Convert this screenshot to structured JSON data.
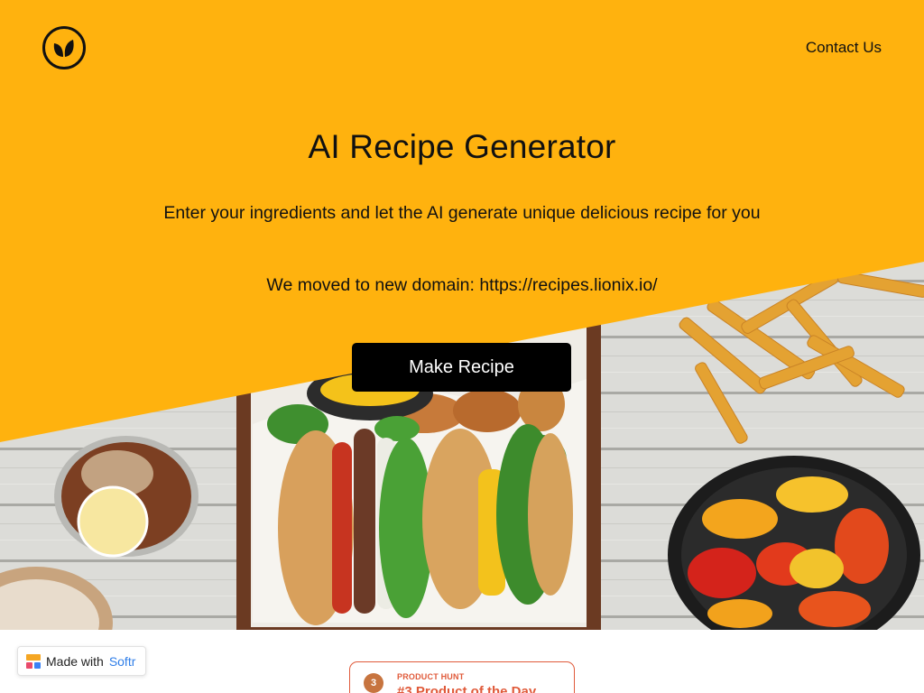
{
  "header": {
    "logo_icon": "leaf-icon",
    "contact_label": "Contact Us"
  },
  "hero": {
    "title": "AI Recipe Generator",
    "subtitle": "Enter your ingredients and let the AI generate unique delicious recipe for you",
    "domain_note": "We moved to new domain: https://recipes.lionix.io/",
    "cta_label": "Make Recipe",
    "background_image": "food-table-photo (burgers, fries, grilled peppers, iced drink)"
  },
  "softr_badge": {
    "prefix": "Made with",
    "brand": "Softr"
  },
  "product_hunt_badge": {
    "medal": "3",
    "kicker": "PRODUCT HUNT",
    "rank": "#3 Product of the Day"
  },
  "colors": {
    "accent_yellow": "#FFB20E",
    "cta_bg": "#000000",
    "ph_orange": "#E05A3A",
    "softr_blue": "#2F7EE8"
  }
}
